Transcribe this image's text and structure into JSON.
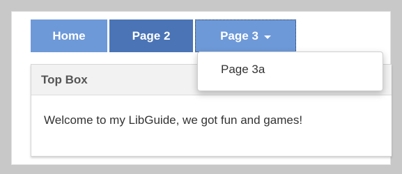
{
  "nav": {
    "tabs": [
      {
        "label": "Home"
      },
      {
        "label": "Page 2"
      },
      {
        "label": "Page 3"
      }
    ],
    "dropdown_items": [
      {
        "label": "Page 3a"
      }
    ]
  },
  "box": {
    "title": "Top Box",
    "body": "Welcome to my LibGuide, we got fun and games!"
  },
  "colors": {
    "tab": "#6d99d8",
    "tab_active": "#4a74b6",
    "page_bg": "#c8c8c8"
  },
  "icons": [
    "caret-down-icon"
  ]
}
